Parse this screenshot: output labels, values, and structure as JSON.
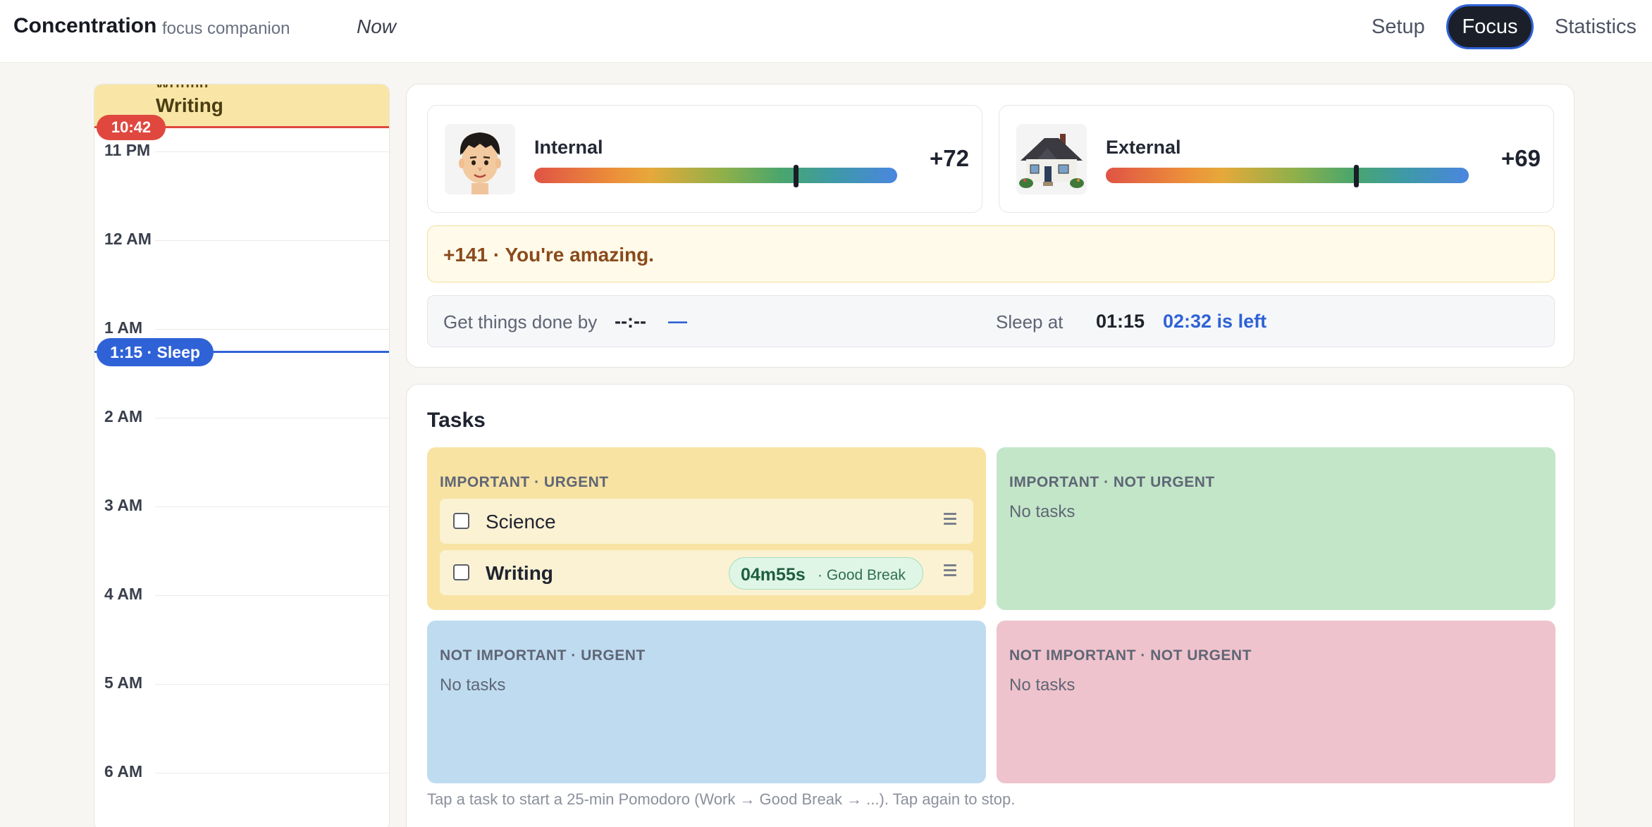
{
  "header": {
    "brand": "Concentration",
    "subtitle": "focus companion",
    "now_link": "Now",
    "nav": {
      "setup": "Setup",
      "focus": "Focus",
      "statistics": "Statistics",
      "active": "Focus"
    }
  },
  "timeline": {
    "current_event": "Writing",
    "now_time": "10:42",
    "sleep_marker": "1:15 · Sleep",
    "hours": [
      "11 PM",
      "12 AM",
      "1 AM",
      "2 AM",
      "3 AM",
      "4 AM",
      "5 AM",
      "6 AM"
    ]
  },
  "status": {
    "internal": {
      "label": "Internal",
      "value": "+72",
      "score": 72,
      "icon": "boy-avatar-icon"
    },
    "external": {
      "label": "External",
      "value": "+69",
      "score": 69,
      "icon": "house-icon"
    },
    "praise": "+141 · You're amazing.",
    "deadline": {
      "label": "Get things done by",
      "time": "--:--",
      "remaining": "—"
    },
    "sleep": {
      "label": "Sleep at",
      "time": "01:15",
      "remaining": "02:32 is left"
    }
  },
  "tasks": {
    "title": "Tasks",
    "quadrants": [
      {
        "title": "IMPORTANT · URGENT",
        "color": "#f8e3a3",
        "items": [
          {
            "name": "Science",
            "active": false
          },
          {
            "name": "Writing",
            "active": true,
            "timer": "04m55s",
            "phase": "· Good Break"
          }
        ]
      },
      {
        "title": "IMPORTANT · NOT URGENT",
        "color": "#c3e6c9",
        "empty": "No tasks"
      },
      {
        "title": "NOT IMPORTANT · URGENT",
        "color": "#bfdbf0",
        "empty": "No tasks"
      },
      {
        "title": "NOT IMPORTANT · NOT URGENT",
        "color": "#efc3cd",
        "empty": "No tasks"
      }
    ],
    "hint": "Tap a task to start a 25-min Pomodoro (Work → Good Break → ...). Tap again to stop."
  },
  "colors": {
    "accent": "#2f62d6",
    "now_marker": "#e0483f",
    "praise_text": "#8a4a1c"
  }
}
